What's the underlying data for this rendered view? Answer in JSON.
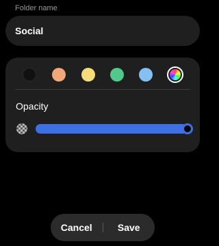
{
  "folder": {
    "label": "Folder name",
    "name": "Social"
  },
  "colors": {
    "swatches": [
      {
        "name": "black",
        "hex": "#111111"
      },
      {
        "name": "orange",
        "hex": "#f0a878"
      },
      {
        "name": "yellow",
        "hex": "#f5dc7c"
      },
      {
        "name": "green",
        "hex": "#52c98a"
      },
      {
        "name": "blue",
        "hex": "#86bff2"
      },
      {
        "name": "custom",
        "hex": "rainbow",
        "selected": true
      }
    ]
  },
  "opacity": {
    "label": "Opacity",
    "value": 1.0,
    "accent": "#3f6fe4"
  },
  "actions": {
    "cancel": "Cancel",
    "save": "Save"
  }
}
